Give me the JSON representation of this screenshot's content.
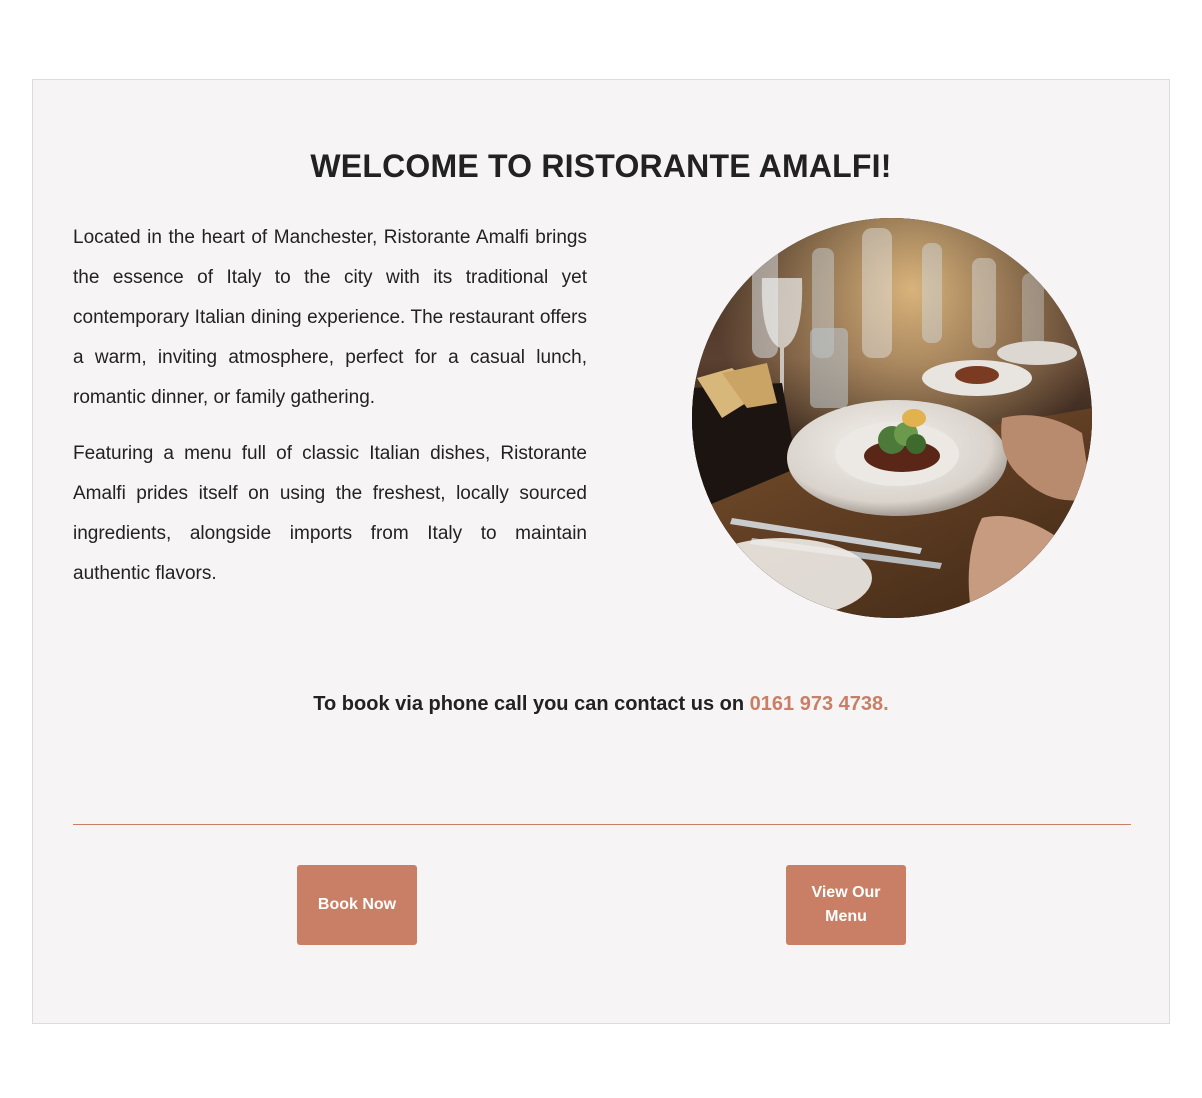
{
  "welcome": {
    "title": "WELCOME TO RISTORANTE AMALFI!",
    "paragraph_1": "Located in the heart of Manchester, Ristorante Amalfi brings the essence of Italy to the city with its traditional yet contemporary Italian dining experience. The restaurant offers a warm, inviting atmosphere, perfect for a casual lunch, romantic dinner, or family gathering.",
    "paragraph_2": "Featuring a menu full of classic Italian dishes, Ristorante Amalfi prides itself on using the freshest, locally sourced ingredients, alongside imports from Italy to maintain authentic flavors.",
    "image": "restaurant-table-dining-photo"
  },
  "contact": {
    "text": "To book via phone call you can contact us on ",
    "phone": "0161 973 4738."
  },
  "actions": {
    "book_label": "Book Now",
    "menu_label": "View Our Menu"
  },
  "colors": {
    "accent": "#c97f66",
    "card_background": "#f6f4f5",
    "text": "#222222"
  }
}
